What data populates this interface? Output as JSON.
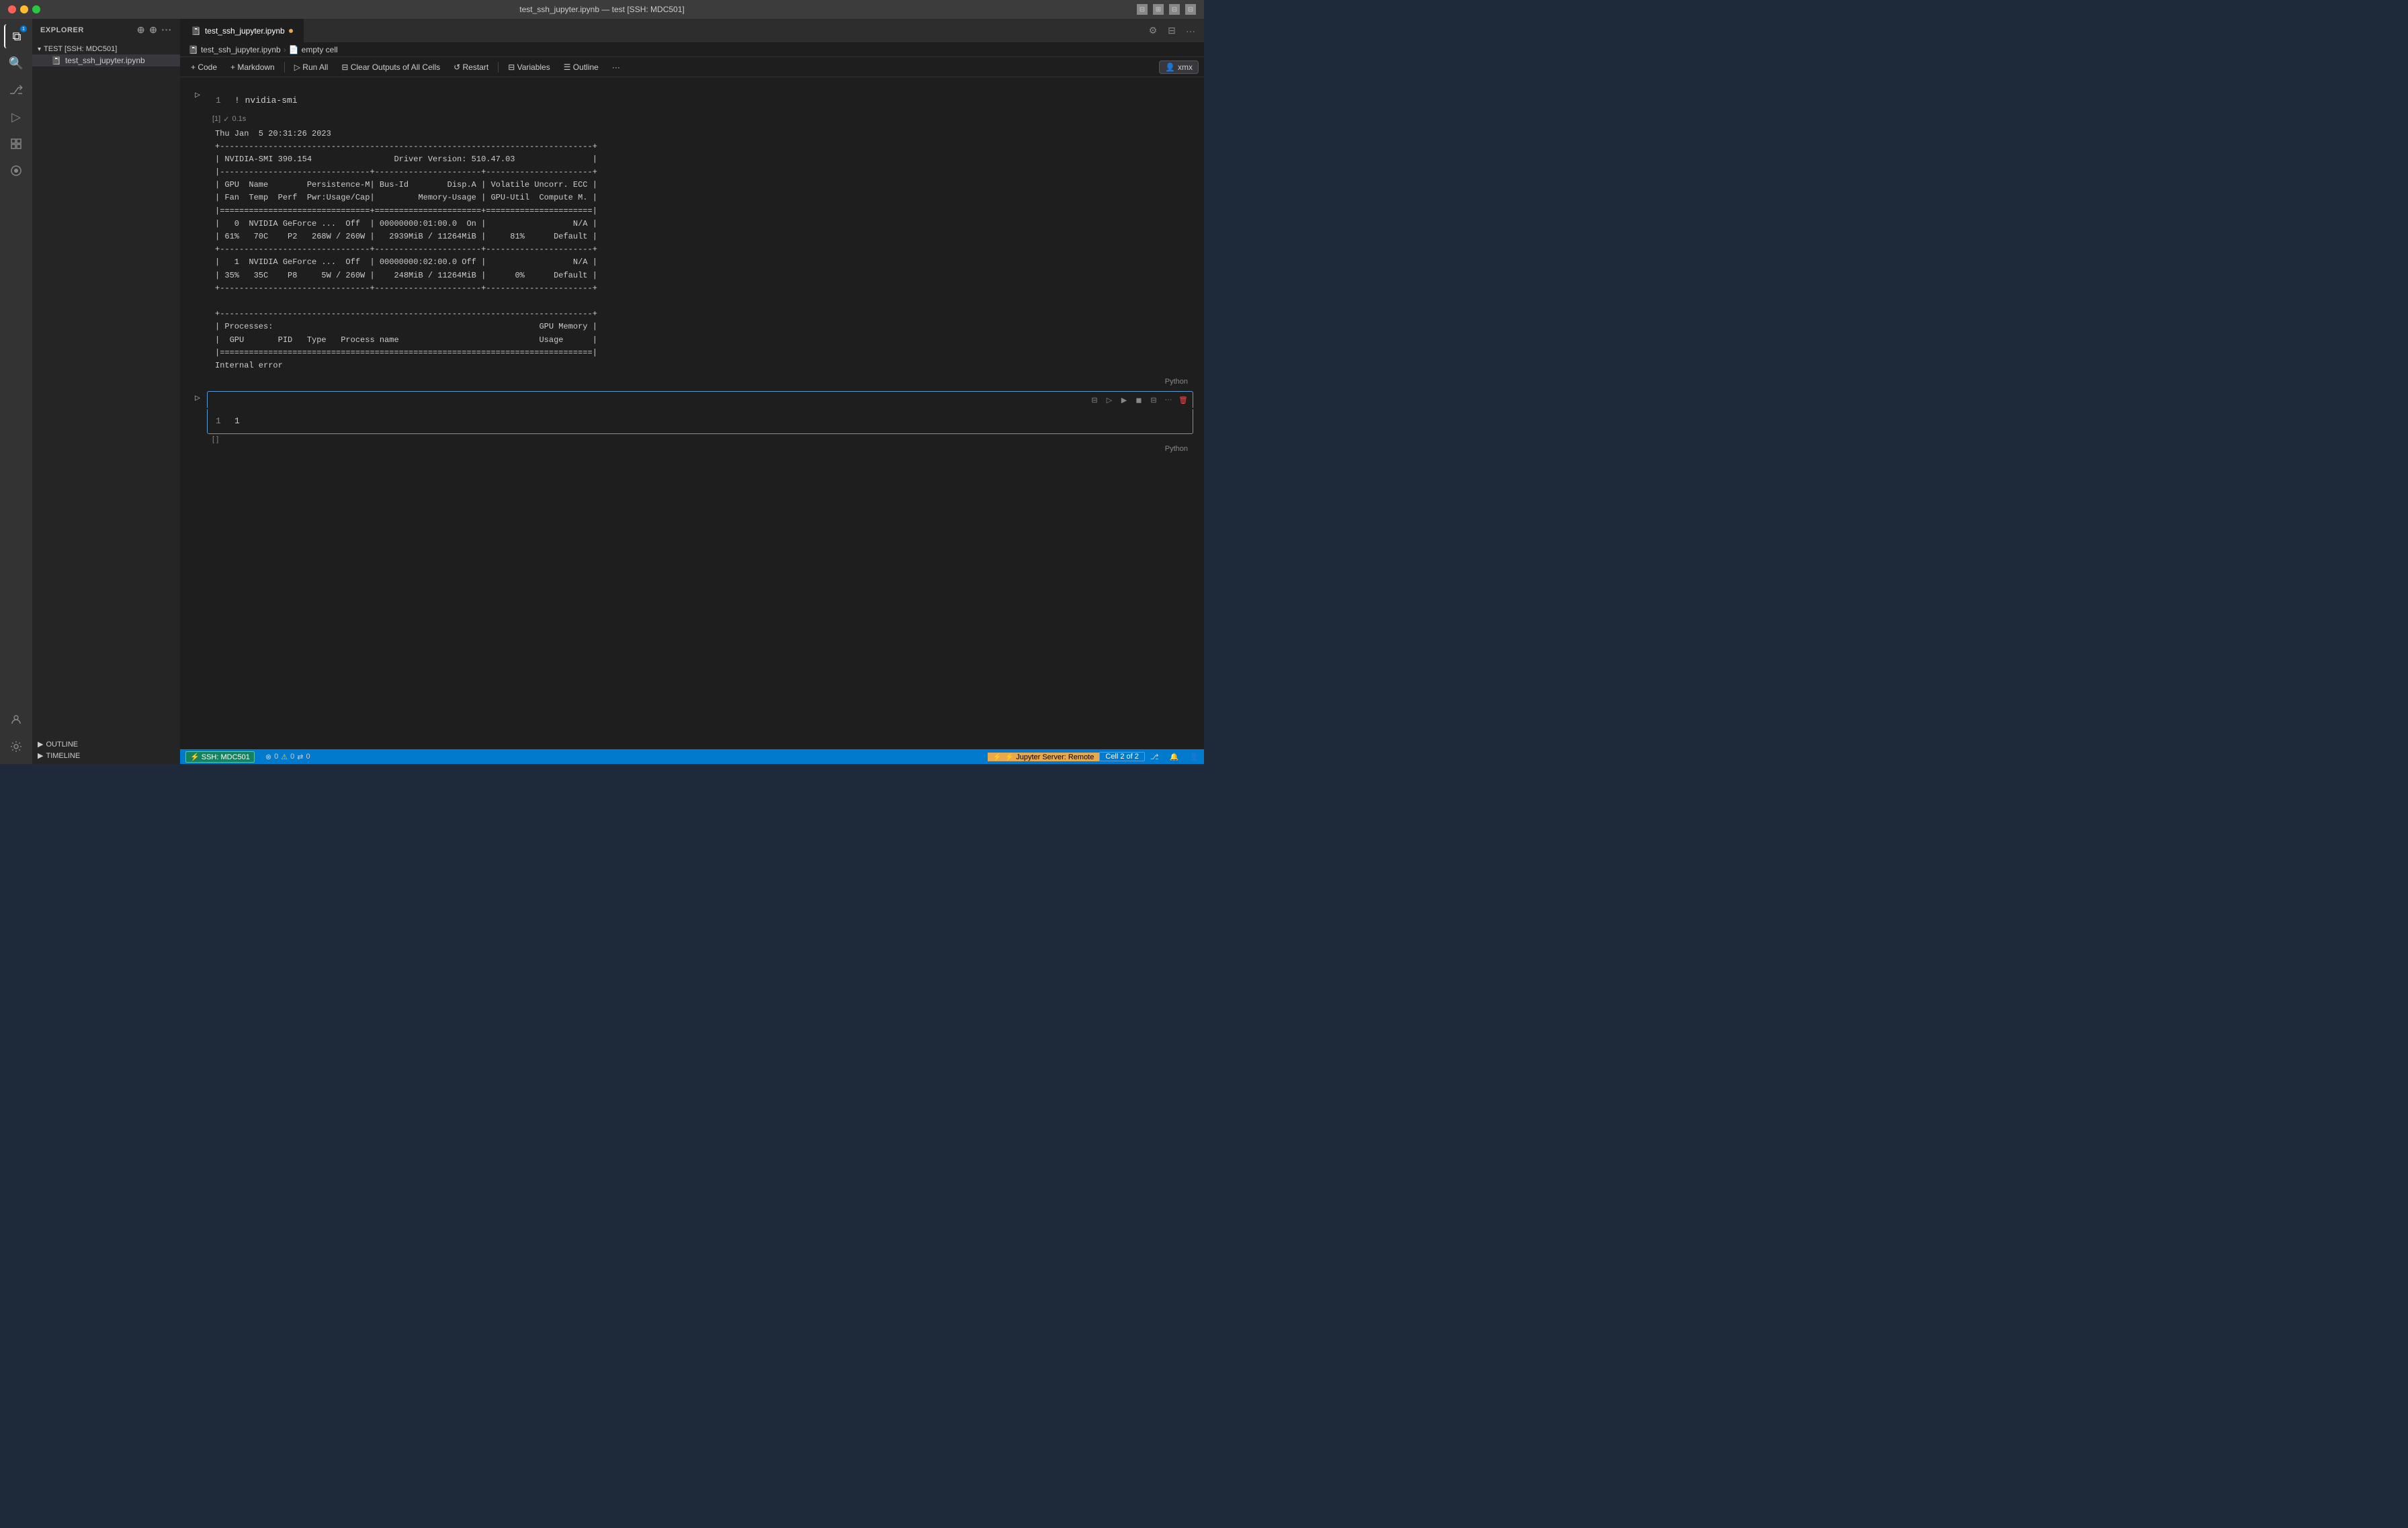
{
  "titlebar": {
    "title": "test_ssh_jupyter.ipynb — test [SSH: MDC501]",
    "icons": [
      "grid2",
      "grid3",
      "grid4",
      "more"
    ]
  },
  "activity_bar": {
    "icons": [
      {
        "name": "files",
        "symbol": "⧉",
        "active": true,
        "badge": "1"
      },
      {
        "name": "search",
        "symbol": "🔍",
        "active": false
      },
      {
        "name": "source-control",
        "symbol": "⎇",
        "active": false
      },
      {
        "name": "run",
        "symbol": "▷",
        "active": false
      },
      {
        "name": "extensions",
        "symbol": "⊞",
        "active": false
      },
      {
        "name": "jupyter",
        "symbol": "⬡",
        "active": false
      }
    ],
    "bottom_icons": [
      {
        "name": "account",
        "symbol": "👤"
      },
      {
        "name": "settings",
        "symbol": "⚙"
      }
    ]
  },
  "sidebar": {
    "header": "Explorer",
    "tree_label": "TEST [SSH: MDC501]",
    "file": "test_ssh_jupyter.ipynb",
    "outline_label": "OUTLINE",
    "timeline_label": "TIMELINE"
  },
  "tab": {
    "filename": "test_ssh_jupyter.ipynb",
    "modified": true,
    "icon": "📓"
  },
  "breadcrumb": {
    "parts": [
      "test_ssh_jupyter.ipynb",
      "empty cell"
    ],
    "icons": [
      "📓",
      "📄"
    ]
  },
  "toolbar": {
    "code_label": "+ Code",
    "markdown_label": "+ Markdown",
    "run_all_label": "▷ Run All",
    "clear_label": "⊟ Clear Outputs of All Cells",
    "restart_label": "↺ Restart",
    "variables_label": "⊟ Variables",
    "outline_label": "☰ Outline",
    "more_label": "···",
    "xmx_label": "xmx",
    "top_icons": [
      "gear",
      "split",
      "more"
    ]
  },
  "cell1": {
    "line_number": "1",
    "code": "! nvidia-smi",
    "execution_count": "[1]",
    "status_check": "✓",
    "status_time": "0.1s",
    "lang": "Python",
    "output": "Thu Jan  5 20:31:26 2023\n+-----------------------------------------------------------------------------+\n| NVIDIA-SMI 390.154                 Driver Version: 510.47.03                |\n|-------------------------------+----------------------+----------------------+\n| GPU  Name        Persistence-M| Bus-Id        Disp.A | Volatile Uncorr. ECC |\n| Fan  Temp  Perf  Pwr:Usage/Cap|         Memory-Usage | GPU-Util  Compute M. |\n|===============================+======================+======================|\n|   0  NVIDIA GeForce ...  Off  | 00000000:01:00.0  On |                  N/A |\n| 61%   70C    P2   268W / 260W |   2939MiB / 11264MiB |     81%      Default |\n+-------------------------------+----------------------+----------------------+\n|   1  NVIDIA GeForce ...  Off  | 00000000:02:00.0 Off |                  N/A |\n| 35%   35C    P8     5W / 260W |    248MiB / 11264MiB |      0%      Default |\n+-------------------------------+----------------------+----------------------+\n\n+-----------------------------------------------------------------------------+\n| Processes:                                                       GPU Memory |\n|  GPU       PID   Type   Process name                             Usage      |\n|=============================================================================|\nInternal error"
  },
  "cell2": {
    "line_number": "1",
    "code": "1",
    "execution_count": "[ ]",
    "lang": "Python",
    "cell_toolbar": {
      "icons": [
        "format",
        "run-above",
        "run",
        "interrupt",
        "clear",
        "more",
        "delete"
      ]
    }
  },
  "status_bar": {
    "ssh_label": "⚡ SSH: MDC501",
    "errors": "0",
    "warnings": "0",
    "ports": "0",
    "jupyter_label": "⚡ Jupyter Server: Remote",
    "cell_count": "Cell 2 of 2",
    "right_icons": [
      "branch",
      "bell",
      "account"
    ]
  }
}
